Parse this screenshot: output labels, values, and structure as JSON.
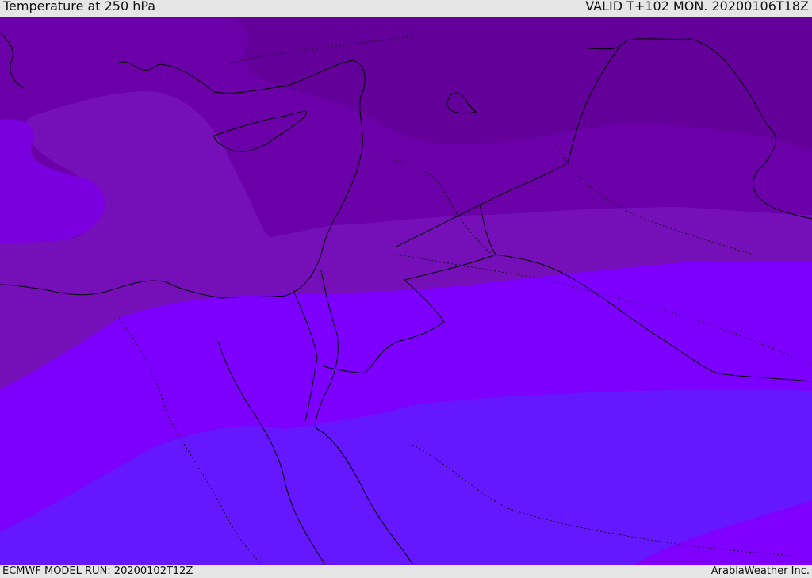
{
  "header": {
    "title": "Temperature at 250 hPa",
    "valid": "VALID T+102 MON. 20200106T18Z"
  },
  "footer": {
    "model_run": "ECMWF MODEL RUN: 20200102T12Z",
    "credit": "ArabiaWeather Inc."
  },
  "map": {
    "field": "temperature-250hPa",
    "colors": {
      "band_darkest": "#620099",
      "band_dark": "#6b00a8",
      "band_mid": "#7510b8",
      "band_purple": "#7b00e0",
      "band_violet": "#7d00ff",
      "band_blue": "#6518ff",
      "band_bright": "#8000ff",
      "coastline": "#000000"
    }
  }
}
